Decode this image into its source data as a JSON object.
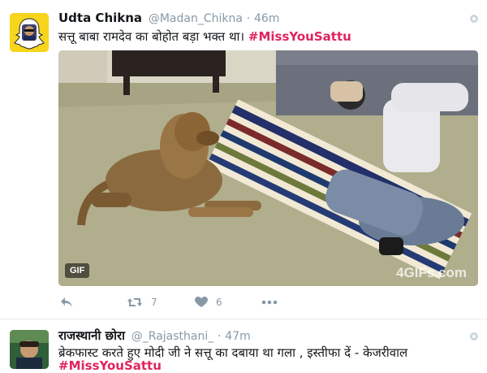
{
  "tweets": [
    {
      "name": "Udta Chikna",
      "handle": "@Madan_Chikna",
      "separator": "·",
      "time": "46m",
      "text": "सत्तू बाबा रामदेव का बोहोत बड़ा भक्त था।",
      "hashtag": "#MissYouSattu",
      "media": {
        "badge": "GIF",
        "watermark": "4GIFs.com"
      },
      "actions": {
        "reply_icon": "reply-icon",
        "retweet_icon": "retweet-icon",
        "retweet_count": "7",
        "like_icon": "heart-icon",
        "like_count": "6",
        "more_icon": "more-dots-icon"
      },
      "colors": {
        "avatar_bg": "#f7d51d",
        "hashtag": "#e0245e"
      }
    },
    {
      "name": "राजस्थानी छोरा",
      "handle": "@_Rajasthani_",
      "separator": "·",
      "time": "47m",
      "text": "ब्रेकफास्ट करते हुए मोदी जी ने सत्तू का दबाया था गला , इस्तीफा दें - केजरीवाल",
      "hashtag": "#MissYouSattu"
    }
  ]
}
